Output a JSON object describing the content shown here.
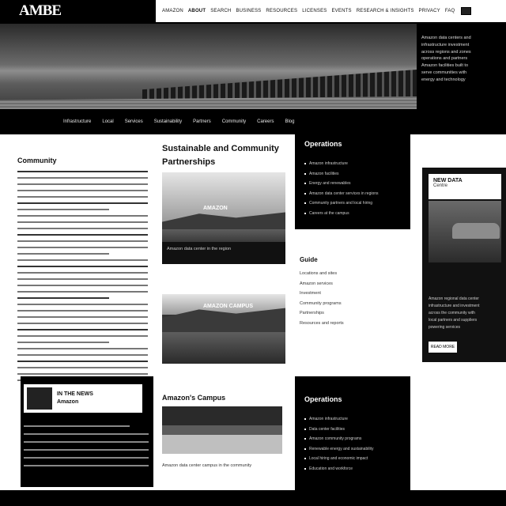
{
  "header": {
    "logo": "AMBE",
    "nav": [
      "AMAZON",
      "ABOUT",
      "SEARCH",
      "BUSINESS",
      "RESOURCES",
      "LICENSES",
      "EVENTS",
      "RESEARCH & INSIGHTS",
      "PRIVACY",
      "FAQ"
    ]
  },
  "hero": {
    "side_lines": [
      "Amazon data centers and",
      "infrastructure investment",
      "across regions and zones",
      "operations and partners",
      "Amazon facilities built to",
      "serve communities with",
      "energy and technology"
    ]
  },
  "subnav": [
    "Infrastructure",
    "Local",
    "Services",
    "Sustainability",
    "Partners",
    "Community",
    "Careers",
    "Blog"
  ],
  "article": {
    "title": "Community"
  },
  "col2": {
    "title": "Sustainable and Community Partnerships",
    "photo1": {
      "caption": "AMAZON",
      "foot": "Amazon data center in the region"
    },
    "photo2": {
      "caption": "AMAZON CAMPUS"
    }
  },
  "col3": {
    "top_title": "Operations",
    "top_items": [
      "Amazon infrastructure",
      "Amazon facilities",
      "Energy and renewables",
      "Amazon data center services in regions",
      "Community partners and local hiring",
      "Careers at the campus"
    ],
    "mid_title": "Guide",
    "mid_items": [
      "Locations and sites",
      "Amazon services",
      "Investment",
      "Community programs",
      "Partnerships",
      "Resources and reports"
    ],
    "bot_title": "Operations",
    "bot_items": [
      "Amazon infrastructure",
      "Data center facilities",
      "Amazon community programs",
      "Renewable energy and sustainability",
      "Local hiring and economic impact",
      "Education and workforce"
    ]
  },
  "col4": {
    "card_title": "NEW DATA",
    "card_sub": "Centre",
    "lines": [
      "Amazon regional data center",
      "infrastructure and investment",
      "across the community with",
      "local partners and suppliers",
      "powering services"
    ],
    "button": "READ MORE"
  },
  "bottom": {
    "card1_title": "IN THE NEWS",
    "card1_sub": "Amazon",
    "card2_title": "Amazon's Campus",
    "card2_foot": "Amazon data center campus in the community"
  }
}
